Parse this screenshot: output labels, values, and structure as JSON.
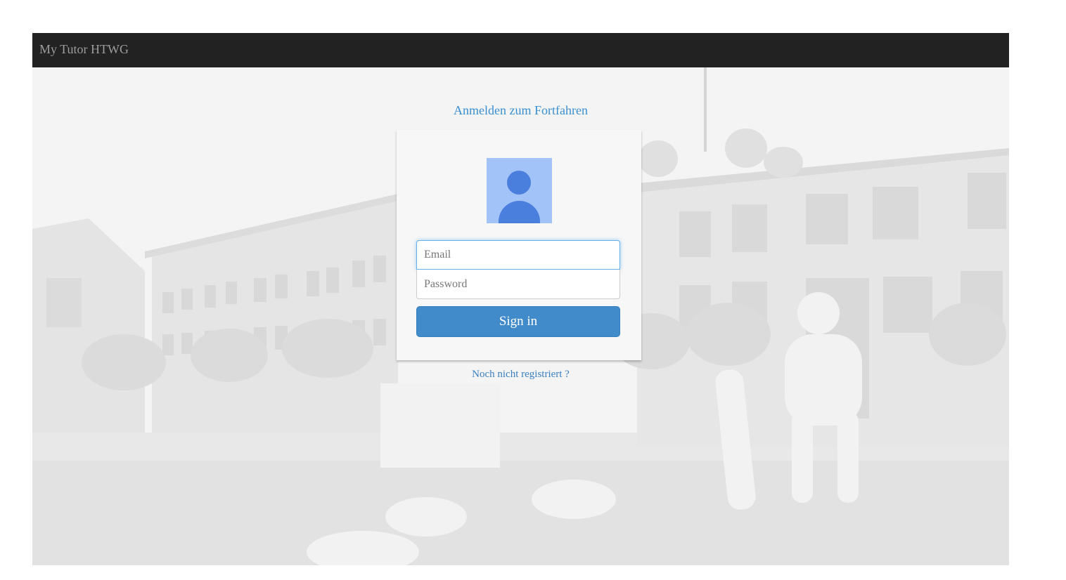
{
  "navbar": {
    "brand": "My Tutor HTWG"
  },
  "login": {
    "heading": "Anmelden zum Fortfahren",
    "email_placeholder": "Email",
    "password_placeholder": "Password",
    "signin_label": "Sign in",
    "register_link": "Noch nicht registriert ?"
  },
  "icons": {
    "avatar": "user-avatar-icon"
  },
  "colors": {
    "navbar_bg": "#222222",
    "brand_text": "#9d9d9d",
    "accent": "#428bca",
    "heading": "#3a8fd0",
    "avatar_bg": "#a2c3f8",
    "avatar_fg": "#4b7fde"
  }
}
